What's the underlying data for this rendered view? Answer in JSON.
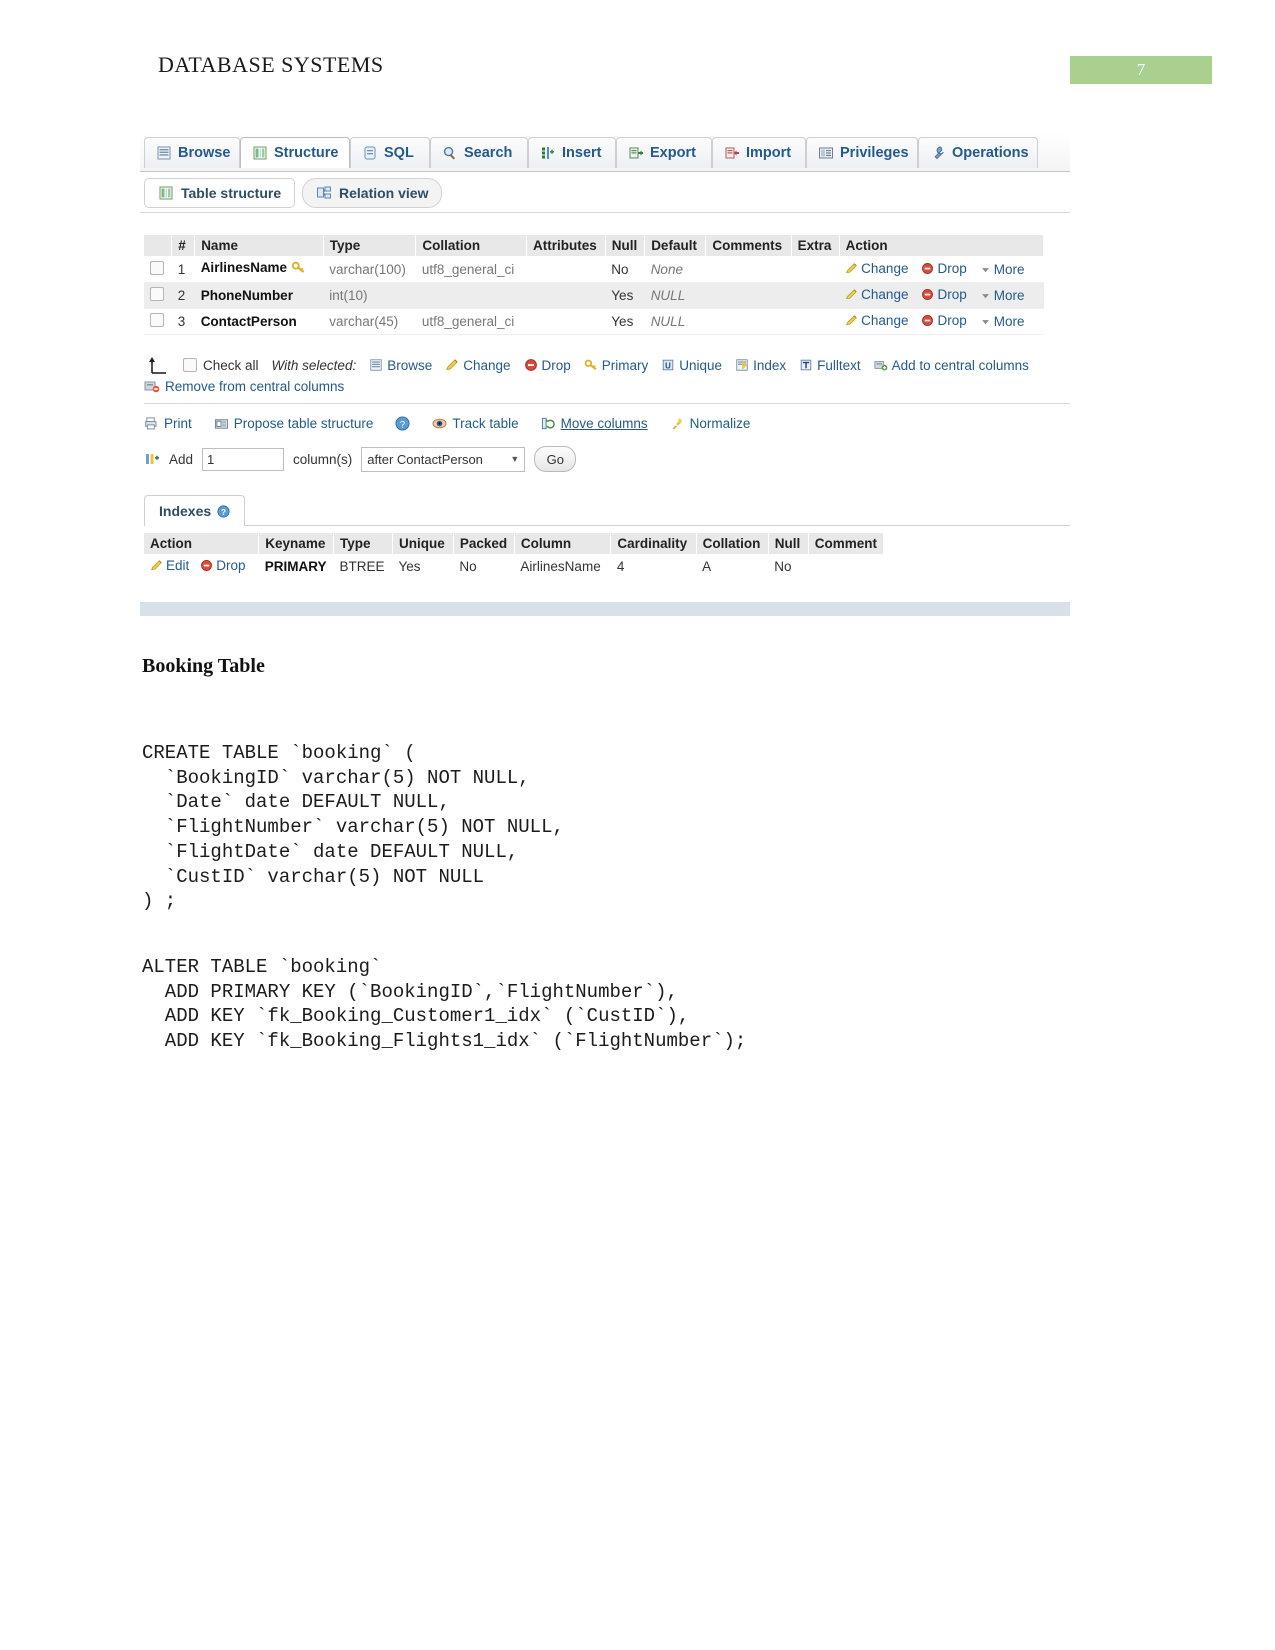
{
  "page": {
    "doc_title": "DATABASE SYSTEMS",
    "page_number": "7"
  },
  "phpmyadmin": {
    "main_tabs": [
      {
        "label": "Browse",
        "icon": "browse-icon",
        "active": false
      },
      {
        "label": "Structure",
        "icon": "structure-icon",
        "active": true
      },
      {
        "label": "SQL",
        "icon": "sql-icon",
        "active": false
      },
      {
        "label": "Search",
        "icon": "search-icon",
        "active": false
      },
      {
        "label": "Insert",
        "icon": "insert-icon",
        "active": false
      },
      {
        "label": "Export",
        "icon": "export-icon",
        "active": false
      },
      {
        "label": "Import",
        "icon": "import-icon",
        "active": false
      },
      {
        "label": "Privileges",
        "icon": "privileges-icon",
        "active": false
      },
      {
        "label": "Operations",
        "icon": "operations-icon",
        "active": false
      }
    ],
    "sub_tabs": [
      {
        "label": "Table structure",
        "icon": "table-structure-icon"
      },
      {
        "label": "Relation view",
        "icon": "relation-view-icon"
      }
    ],
    "structure_table": {
      "headers": [
        "",
        "#",
        "Name",
        "Type",
        "Collation",
        "Attributes",
        "Null",
        "Default",
        "Comments",
        "Extra",
        "Action"
      ],
      "rows": [
        {
          "num": "1",
          "name": "AirlinesName",
          "key_icon": "primary-key-icon",
          "type": "varchar(100)",
          "collation": "utf8_general_ci",
          "attributes": "",
          "null": "No",
          "default": "None",
          "comments": "",
          "extra": "",
          "actions": [
            "Change",
            "Drop",
            "More"
          ]
        },
        {
          "num": "2",
          "name": "PhoneNumber",
          "key_icon": "",
          "type": "int(10)",
          "collation": "",
          "attributes": "",
          "null": "Yes",
          "default": "NULL",
          "comments": "",
          "extra": "",
          "actions": [
            "Change",
            "Drop",
            "More"
          ]
        },
        {
          "num": "3",
          "name": "ContactPerson",
          "key_icon": "",
          "type": "varchar(45)",
          "collation": "utf8_general_ci",
          "attributes": "",
          "null": "Yes",
          "default": "NULL",
          "comments": "",
          "extra": "",
          "actions": [
            "Change",
            "Drop",
            "More"
          ]
        }
      ]
    },
    "with_selected": {
      "check_all_label": "Check all",
      "with_selected_label": "With selected:",
      "actions": [
        {
          "label": "Browse",
          "icon": "browse-icon"
        },
        {
          "label": "Change",
          "icon": "pencil-icon"
        },
        {
          "label": "Drop",
          "icon": "drop-icon"
        },
        {
          "label": "Primary",
          "icon": "primary-key-icon"
        },
        {
          "label": "Unique",
          "icon": "unique-icon"
        },
        {
          "label": "Index",
          "icon": "index-icon"
        },
        {
          "label": "Fulltext",
          "icon": "fulltext-icon"
        },
        {
          "label": "Add to central columns",
          "icon": "add-central-columns-icon"
        }
      ],
      "remove_central_label": "Remove from central columns"
    },
    "tools_row": [
      {
        "label": "Print",
        "icon": "print-icon"
      },
      {
        "label": "Propose table structure",
        "icon": "propose-structure-icon"
      },
      {
        "label": "",
        "icon": "help-icon"
      },
      {
        "label": "Track table",
        "icon": "track-table-icon"
      },
      {
        "label": "Move columns",
        "icon": "move-columns-icon"
      },
      {
        "label": "Normalize",
        "icon": "normalize-icon"
      }
    ],
    "add_row": {
      "add_label": "Add",
      "count_value": "1",
      "columns_label": "column(s)",
      "position_value": "after ContactPerson",
      "go_label": "Go"
    },
    "indexes": {
      "panel_label": "Indexes",
      "headers": [
        "Action",
        "Keyname",
        "Type",
        "Unique",
        "Packed",
        "Column",
        "Cardinality",
        "Collation",
        "Null",
        "Comment"
      ],
      "rows": [
        {
          "edit_label": "Edit",
          "drop_label": "Drop",
          "keyname": "PRIMARY",
          "type": "BTREE",
          "unique": "Yes",
          "packed": "No",
          "column": "AirlinesName",
          "cardinality": "4",
          "collation": "A",
          "null": "No",
          "comment": ""
        }
      ]
    }
  },
  "document": {
    "section_title": "Booking Table",
    "create_sql": "CREATE TABLE `booking` (\n  `BookingID` varchar(5) NOT NULL,\n  `Date` date DEFAULT NULL,\n  `FlightNumber` varchar(5) NOT NULL,\n  `FlightDate` date DEFAULT NULL,\n  `CustID` varchar(5) NOT NULL\n) ;",
    "alter_sql": "ALTER TABLE `booking`\n  ADD PRIMARY KEY (`BookingID`,`FlightNumber`),\n  ADD KEY `fk_Booking_Customer1_idx` (`CustID`),\n  ADD KEY `fk_Booking_Flights1_idx` (`FlightNumber`);"
  },
  "colors": {
    "page_badge": "#a9d08e",
    "link": "#235a8b",
    "header_bg": "#e8e8e8",
    "row_alt": "#ededed"
  }
}
